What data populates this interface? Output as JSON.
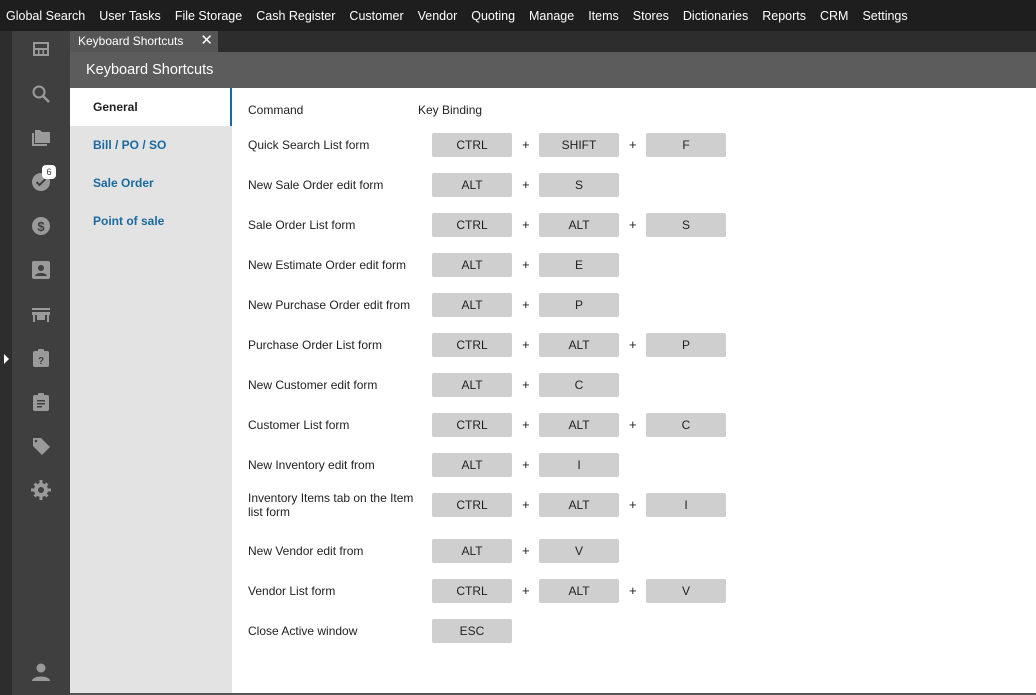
{
  "menu": [
    "Global Search",
    "User Tasks",
    "File Storage",
    "Cash Register",
    "Customer",
    "Vendor",
    "Quoting",
    "Manage",
    "Items",
    "Stores",
    "Dictionaries",
    "Reports",
    "CRM",
    "Settings"
  ],
  "sidebar": {
    "tasks_badge": "6"
  },
  "tab": {
    "label": "Keyboard Shortcuts",
    "close": "✕"
  },
  "header": {
    "title": "Keyboard Shortcuts"
  },
  "nav": [
    "General",
    "Bill / PO / SO",
    "Sale Order",
    "Point of sale"
  ],
  "columns": {
    "command": "Command",
    "binding": "Key Binding"
  },
  "plus": "+",
  "shortcuts": [
    {
      "command": "Quick Search List form",
      "keys": [
        "CTRL",
        "SHIFT",
        "F"
      ]
    },
    {
      "command": "New Sale Order edit form",
      "keys": [
        "ALT",
        "S"
      ]
    },
    {
      "command": "Sale Order List form",
      "keys": [
        "CTRL",
        "ALT",
        "S"
      ]
    },
    {
      "command": "New Estimate Order edit form",
      "keys": [
        "ALT",
        "E"
      ]
    },
    {
      "command": "New Purchase Order edit from",
      "keys": [
        "ALT",
        "P"
      ]
    },
    {
      "command": "Purchase Order List form",
      "keys": [
        "CTRL",
        "ALT",
        "P"
      ]
    },
    {
      "command": "New Customer edit form",
      "keys": [
        "ALT",
        "C"
      ]
    },
    {
      "command": "Customer List form",
      "keys": [
        "CTRL",
        "ALT",
        "C"
      ]
    },
    {
      "command": "New Inventory edit from",
      "keys": [
        "ALT",
        "I"
      ]
    },
    {
      "command": "Inventory Items tab on the Item list form",
      "keys": [
        "CTRL",
        "ALT",
        "I"
      ]
    },
    {
      "command": "New Vendor edit from",
      "keys": [
        "ALT",
        "V"
      ]
    },
    {
      "command": "Vendor List form",
      "keys": [
        "CTRL",
        "ALT",
        "V"
      ]
    },
    {
      "command": "Close Active window",
      "keys": [
        "ESC"
      ]
    }
  ]
}
